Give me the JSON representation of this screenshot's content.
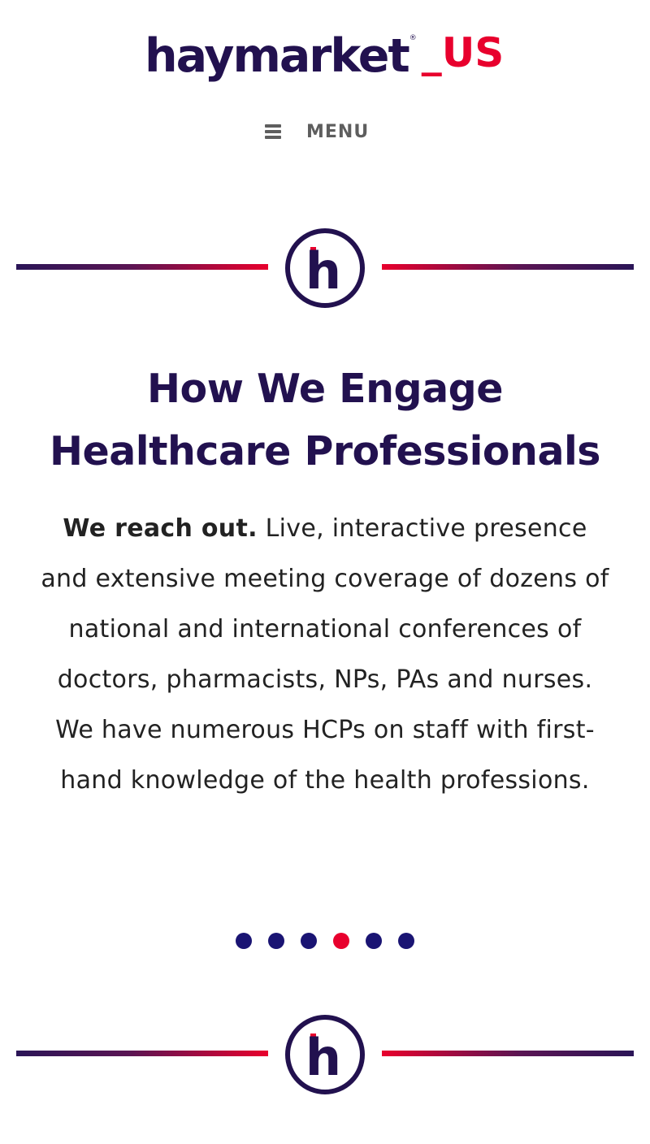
{
  "header": {
    "logo_brand": "haymarket",
    "logo_registered": "®",
    "logo_region": "_US",
    "menu_label": "MENU"
  },
  "section": {
    "badge_letter": "h",
    "title_line1": "How We Engage",
    "title_line2": "Healthcare Professionals",
    "body_lead": "We reach out.",
    "body_text": " Live, interactive presence and extensive meeting coverage of dozens of national and international conferences of doctors, pharmacists, NPs, PAs and nurses. We have numerous HCPs on staff with first-hand knowledge of the health professions."
  },
  "carousel": {
    "slide_count": 6,
    "active_index": 3
  },
  "colors": {
    "brand_navy": "#22114f",
    "brand_red": "#e8002d",
    "dot_inactive": "#1a1473",
    "menu_gray": "#5e5e5e"
  }
}
